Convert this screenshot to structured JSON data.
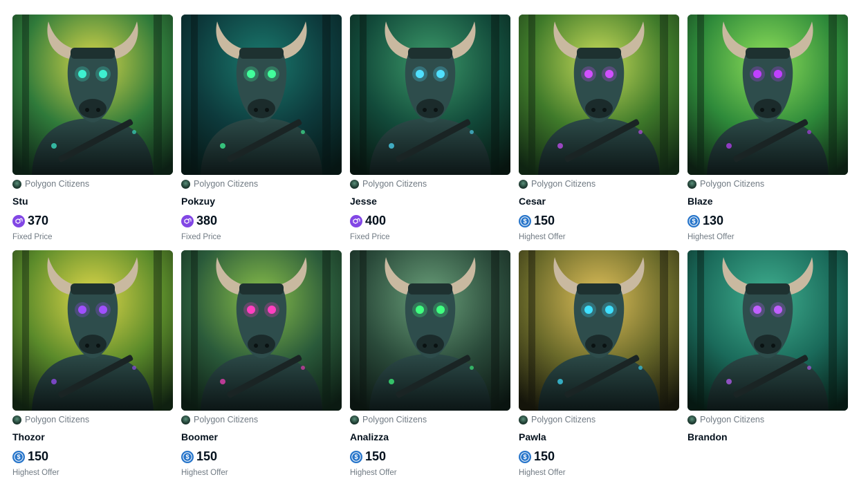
{
  "colors": {
    "matic": "#8247e5",
    "usdc": "#2775ca",
    "text_primary": "#04111d",
    "text_secondary": "#707a83"
  },
  "cards": [
    {
      "collection": "Polygon Citizens",
      "name": "Stu",
      "token": "matic-icon",
      "price": "370",
      "label": "Fixed Price",
      "palette": [
        "#2f7a3a",
        "#d6d64a",
        "#0c1f14",
        "#3ef0d0"
      ]
    },
    {
      "collection": "Polygon Citizens",
      "name": "Pokzuy",
      "token": "matic-icon",
      "price": "380",
      "label": "Fixed Price",
      "palette": [
        "#0d3a3c",
        "#1a7a6e",
        "#061513",
        "#42ff9c"
      ]
    },
    {
      "collection": "Polygon Citizens",
      "name": "Jesse",
      "token": "matic-icon",
      "price": "400",
      "label": "Fixed Price",
      "palette": [
        "#124a3a",
        "#3c9a6a",
        "#07140f",
        "#50e0ff"
      ]
    },
    {
      "collection": "Polygon Citizens",
      "name": "Cesar",
      "token": "usdc-icon",
      "price": "150",
      "label": "Highest Offer",
      "palette": [
        "#3f7a2a",
        "#c8dc5a",
        "#0f2412",
        "#d050ff"
      ]
    },
    {
      "collection": "Polygon Citizens",
      "name": "Blaze",
      "token": "usdc-icon",
      "price": "130",
      "label": "Highest Offer",
      "palette": [
        "#2e8a3a",
        "#8fe05a",
        "#0c1e12",
        "#c040ff"
      ]
    },
    {
      "collection": "Polygon Citizens",
      "name": "Thozor",
      "token": "usdc-icon",
      "price": "150",
      "label": "Highest Offer",
      "palette": [
        "#5a8a2a",
        "#e0d84a",
        "#0f2010",
        "#a050ff"
      ]
    },
    {
      "collection": "Polygon Citizens",
      "name": "Boomer",
      "token": "usdc-icon",
      "price": "150",
      "label": "Highest Offer",
      "palette": [
        "#2a5a3a",
        "#8ac04a",
        "#0b1a12",
        "#ff40c0"
      ]
    },
    {
      "collection": "Polygon Citizens",
      "name": "Analizza",
      "token": "usdc-icon",
      "price": "150",
      "label": "Highest Offer",
      "palette": [
        "#2a4a3a",
        "#6aa07a",
        "#0a1410",
        "#40ff80"
      ]
    },
    {
      "collection": "Polygon Citizens",
      "name": "Pawla",
      "token": "usdc-icon",
      "price": "150",
      "label": "Highest Offer",
      "palette": [
        "#6a6a2a",
        "#e0c05a",
        "#14140a",
        "#40e0ff"
      ]
    },
    {
      "collection": "Polygon Citizens",
      "name": "Brandon",
      "token": "",
      "price": "",
      "label": "",
      "palette": [
        "#1a6a5a",
        "#40b090",
        "#061812",
        "#c060ff"
      ]
    }
  ]
}
